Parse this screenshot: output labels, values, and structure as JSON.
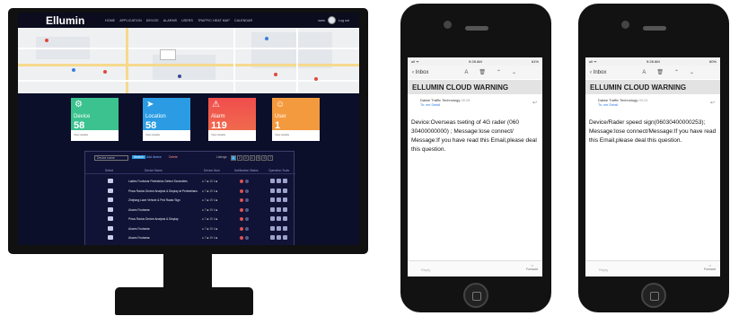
{
  "dashboard": {
    "logo": "Ellumin",
    "nav": [
      "HOME",
      "APPLICATION",
      "DEVICE",
      "ALARMS",
      "USERS",
      "TRAFFIC HEAT MAP",
      "CALENDAR"
    ],
    "user_left": "www",
    "user_right": "Log out",
    "cards": [
      {
        "label": "Device",
        "value": "58",
        "icon": "gear-icon",
        "color": "#3cc28f",
        "foot": "View details"
      },
      {
        "label": "Location",
        "value": "58",
        "icon": "location-arrow-icon",
        "color": "#2b9ce3",
        "foot": "View details"
      },
      {
        "label": "Alarm",
        "value": "119",
        "icon": "alarm-warning-icon",
        "color": "#f04d4d",
        "foot": "View details"
      },
      {
        "label": "User",
        "value": "1",
        "icon": "user-icon",
        "color": "#f49a3e",
        "foot": "View details"
      }
    ],
    "table": {
      "search_placeholder": "Device name",
      "search_button": "Search",
      "add_label": "Add device",
      "delete_label": "Delete",
      "paging_label": "Listings",
      "pages": [
        "1",
        "2",
        "3",
        "4",
        "5",
        "6",
        "7"
      ],
      "columns": [
        "Select",
        "Device Name",
        "Device Num",
        "Notification Status",
        "Operation Tools"
      ],
      "rows": [
        {
          "name": "Ladies Footwear Pedestrian Detect Scrambles",
          "num": "● 7 ■ 19 4 ■"
        },
        {
          "name": "Pinus Rados Device Analysis & Display at Pedestrians",
          "num": "● 7 ■ 19 4 ■"
        },
        {
          "name": "Zhejiang Lane Vehicle & Ped Radar Sign",
          "num": "● 7 ■ 19 4 ■"
        },
        {
          "name": "Aluzes Footwear",
          "num": "● 7 ■ 19 4 ■"
        },
        {
          "name": "Pinus Rados Device Analysis & Display",
          "num": "● 7 ■ 19 4 ■"
        },
        {
          "name": "Aluzes Footwear",
          "num": "● 7 ■ 19 4 ■"
        },
        {
          "name": "Aluzes Footwear",
          "num": "● 7 ■ 19 4 ■"
        }
      ]
    }
  },
  "phones": [
    {
      "time": "9:28 AM",
      "battery": "61%",
      "carrier": "ull ᯤ",
      "back": "Inbox",
      "title": "ELLUMIN CLOUD WARNING",
      "sender": "Dalwe Traffic Technology",
      "sender_time": "09:28",
      "to": "To: me  Detail",
      "body": "Device:Overseas tseting of 4G rader (060 30400000000) ; Message:lose connect/ Message:If you have read this Email,please deal this question.",
      "reply_placeholder": "Reply",
      "forward": "Forward"
    },
    {
      "time": "9:28 AM",
      "battery": "60%",
      "carrier": "ull ᯤ",
      "back": "Inbox",
      "title": "ELLUMIN CLOUD WARNING",
      "sender": "Dalwe Traffic Technology",
      "sender_time": "09:24",
      "to": "To: me  Detail",
      "body": "Device/Rader speed sign(06030400000253); Message:lose connect/Message:If you have read this Email,please deal this question.",
      "reply_placeholder": "Reply",
      "forward": "Forward"
    }
  ]
}
